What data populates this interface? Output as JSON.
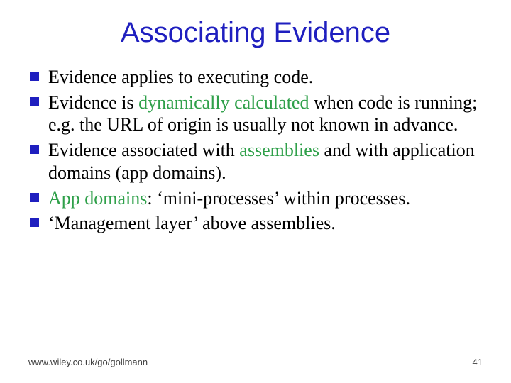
{
  "title": "Associating Evidence",
  "bullets": [
    {
      "pre": "Evidence applies to executing code.",
      "key": "",
      "post": ""
    },
    {
      "pre": "Evidence is ",
      "key": "dynamically calculated",
      "post": " when code is running; e.g. the URL of origin is usually not known in advance."
    },
    {
      "pre": "Evidence associated with ",
      "key": "assemblies",
      "post": " and with application domains (app domains)."
    },
    {
      "pre": "",
      "key": "App domains",
      "post": ": ‘mini-processes’ within processes."
    },
    {
      "pre": "‘Management layer’ above assemblies.",
      "key": "",
      "post": ""
    }
  ],
  "footer": {
    "url": "www.wiley.co.uk/go/gollmann",
    "page": "41"
  }
}
